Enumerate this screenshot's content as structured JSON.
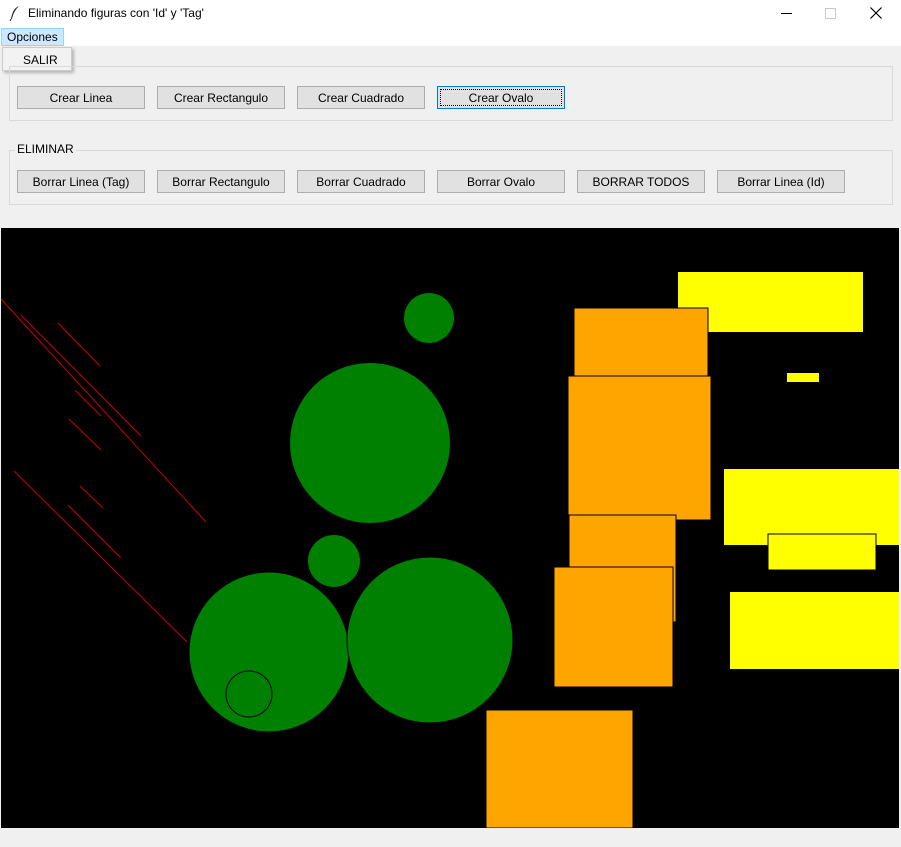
{
  "window": {
    "title": "Eliminando figuras con 'Id' y 'Tag'",
    "icon": "feather-icon",
    "controls": [
      "minimize-icon",
      "maximize-icon",
      "close-icon"
    ]
  },
  "menu": {
    "opciones_label": "Opciones",
    "items": [
      {
        "label": "SALIR"
      }
    ]
  },
  "crear_frame": {
    "label": "",
    "buttons": [
      "Crear Linea",
      "Crear Rectangulo",
      "Crear Cuadrado",
      "Crear Ovalo"
    ]
  },
  "eliminar_frame": {
    "label": "ELIMINAR",
    "buttons": [
      "Borrar Linea (Tag)",
      "Borrar Rectangulo",
      "Borrar Cuadrado",
      "Borrar Ovalo",
      "BORRAR TODOS",
      "Borrar Linea (Id)"
    ]
  },
  "canvas": {
    "background": "#000000",
    "colors": {
      "line": "#cc0000",
      "oval": "#008000",
      "square": "#ffa500",
      "rectangle": "#ffff00"
    }
  }
}
